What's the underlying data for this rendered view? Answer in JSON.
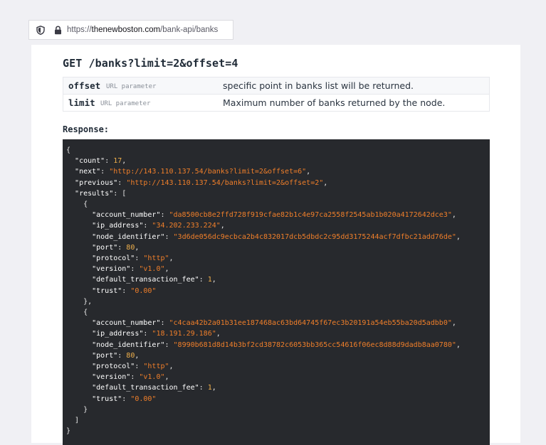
{
  "browser": {
    "url_scheme": "https://",
    "url_domain": "thenewboston.com",
    "url_path": "/bank-api/banks"
  },
  "endpoint": {
    "title": "GET /banks?limit=2&offset=4"
  },
  "params": [
    {
      "name": "offset",
      "type": "URL parameter",
      "description": "specific point in banks list will be returned."
    },
    {
      "name": "limit",
      "type": "URL parameter",
      "description": "Maximum number of banks returned by the node."
    }
  ],
  "response_label": "Response:",
  "response": {
    "count": "17",
    "next": "\"http://143.110.137.54/banks?limit=2&offset=6\"",
    "previous": "\"http://143.110.137.54/banks?limit=2&offset=2\"",
    "results": [
      {
        "account_number": "\"da8500cb8e2ffd728f919cfae82b1c4e97ca2558f2545ab1b020a4172642dce3\"",
        "ip_address": "\"34.202.233.224\"",
        "node_identifier": "\"3d6de056dc9ecbca2b4c832017dcb5dbdc2c95dd3175244acf7dfbc21add76de\"",
        "port": "80",
        "protocol": "\"http\"",
        "version": "\"v1.0\"",
        "default_transaction_fee": "1",
        "trust": "\"0.00\""
      },
      {
        "account_number": "\"c4caa42b2a01b31ee187468ac63bd64745f67ec3b20191a54eb55ba20d5adbb0\"",
        "ip_address": "\"18.191.29.186\"",
        "node_identifier": "\"8990b681d8d14b3bf2cd38782c6053bb365cc54616f06ec8d88d9dadb8aa0780\"",
        "port": "80",
        "protocol": "\"http\"",
        "version": "\"v1.0\"",
        "default_transaction_fee": "1",
        "trust": "\"0.00\""
      }
    ]
  }
}
